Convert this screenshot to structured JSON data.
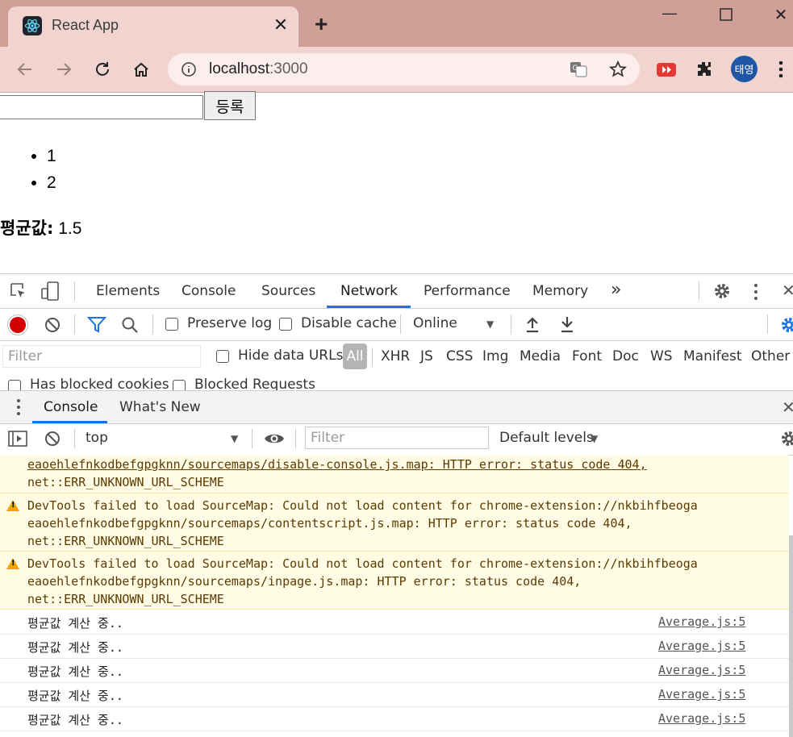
{
  "browser": {
    "tab_title": "React App",
    "url_host": "localhost",
    "url_port": ":3000",
    "avatar_text": "태영",
    "accent_color": "#cfa098"
  },
  "page": {
    "input_value": "",
    "register_label": "등록",
    "list_items": [
      "1",
      "2"
    ],
    "average_label": "평균값:",
    "average_value": "1.5"
  },
  "devtools": {
    "tabs": [
      "Elements",
      "Console",
      "Sources",
      "Network",
      "Performance",
      "Memory"
    ],
    "active_tab": "Network",
    "more_tabs": "»",
    "preserve_log_label": "Preserve log",
    "disable_cache_label": "Disable cache",
    "throttle_value": "Online",
    "filter_placeholder": "Filter",
    "hide_data_urls_label": "Hide data URLs",
    "types": [
      "All",
      "XHR",
      "JS",
      "CSS",
      "Img",
      "Media",
      "Font",
      "Doc",
      "WS",
      "Manifest",
      "Other"
    ],
    "has_blocked_cookies_label": "Has blocked cookies",
    "blocked_requests_label": "Blocked Requests",
    "drawer_tabs": [
      "Console",
      "What's New"
    ],
    "context_value": "top",
    "console_filter_placeholder": "Filter",
    "levels_value": "Default levels"
  },
  "console": {
    "warnings": [
      {
        "lines": [
          "eaoehlefnkodbefgpgknn/sourcemaps/disable-console.js.map: HTTP error: status code 404,",
          "net::ERR_UNKNOWN_URL_SCHEME"
        ],
        "partial": true
      },
      {
        "lines": [
          "DevTools failed to load SourceMap: Could not load content for chrome-extension://nkbihfbeoga",
          "eaoehlefnkodbefgpgknn/sourcemaps/contentscript.js.map: HTTP error: status code 404,",
          "net::ERR_UNKNOWN_URL_SCHEME"
        ],
        "partial": false
      },
      {
        "lines": [
          "DevTools failed to load SourceMap: Could not load content for chrome-extension://nkbihfbeoga",
          "eaoehlefnkodbefgpgknn/sourcemaps/inpage.js.map: HTTP error: status code 404,",
          "net::ERR_UNKNOWN_URL_SCHEME"
        ],
        "partial": false
      }
    ],
    "logs": [
      {
        "text": "평균값 계산 중..",
        "source": "Average.js:5"
      },
      {
        "text": "평균값 계산 중..",
        "source": "Average.js:5"
      },
      {
        "text": "평균값 계산 중..",
        "source": "Average.js:5"
      },
      {
        "text": "평균값 계산 중..",
        "source": "Average.js:5"
      },
      {
        "text": "평균값 계산 중..",
        "source": "Average.js:5"
      }
    ]
  }
}
